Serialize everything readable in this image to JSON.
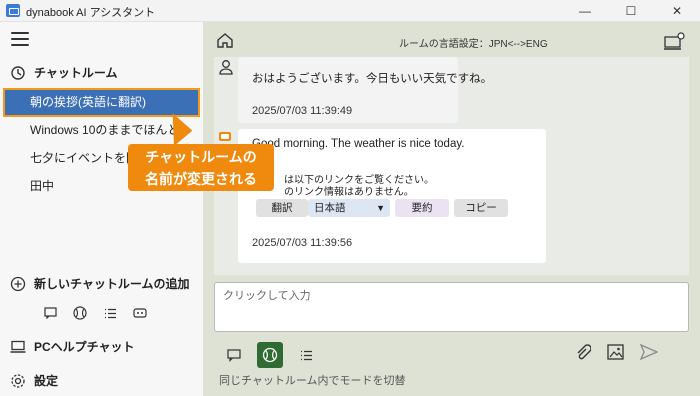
{
  "window": {
    "title": "dynabook AI アシスタント"
  },
  "sidebar": {
    "section_label": "チャットルーム",
    "rooms": [
      {
        "label": "朝の挨拶(英語に翻訳)"
      },
      {
        "label": "Windows 10のままでほんと..."
      },
      {
        "label": "七夕にイベントを開催し..."
      },
      {
        "label": "田中"
      }
    ],
    "add_room_label": "新しいチャットルームの追加",
    "pc_help_label": "PCヘルプチャット",
    "settings_label": "設定"
  },
  "main": {
    "language_setting": "ルームの言語設定：JPN<-->ENG",
    "messages": [
      {
        "text": "おはようございます。今日もいい天気ですね。",
        "time": "2025/07/03 11:39:49"
      },
      {
        "text": "Good morning. The weather is nice today.",
        "line2": "は以下のリンクをご覧ください。",
        "line3": "のリンク情報はありません。",
        "time": "2025/07/03 11:39:56"
      }
    ],
    "actions": {
      "translate_label": "翻訳",
      "language_value": "日本語",
      "summary_label": "要約",
      "copy_label": "コピー"
    },
    "input_placeholder": "クリックして入力",
    "hint": "同じチャットルーム内でモードを切替"
  },
  "callout": {
    "line1": "チャットルームの",
    "line2": "名前が変更される"
  },
  "colors": {
    "active_room": "#3b6fb6",
    "highlight": "#f39a1b",
    "main_bg": "#dde2d5",
    "mode_selected": "#2f6b33"
  }
}
